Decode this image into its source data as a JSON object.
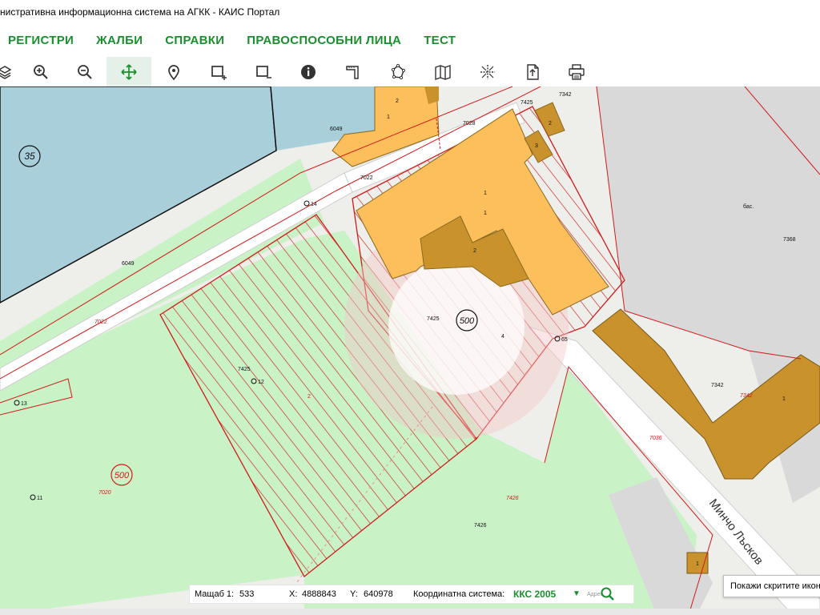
{
  "window": {
    "title": "нистративна информационна система на АГКК - КАИС Портал"
  },
  "menu": {
    "items": [
      "РЕГИСТРИ",
      "ЖАЛБИ",
      "СПРАВКИ",
      "ПРАВОСПОСОБНИ ЛИЦА",
      "ТЕСТ"
    ]
  },
  "toolbar": {
    "tools": [
      {
        "name": "layers-icon",
        "active": false
      },
      {
        "name": "zoom-in-icon",
        "active": false
      },
      {
        "name": "zoom-out-icon",
        "active": false
      },
      {
        "name": "pan-icon",
        "active": true
      },
      {
        "name": "location-pin-icon",
        "active": false
      },
      {
        "name": "select-rectangle-add-icon",
        "active": false
      },
      {
        "name": "select-rectangle-remove-icon",
        "active": false
      },
      {
        "name": "info-icon",
        "active": false
      },
      {
        "name": "measure-distance-icon",
        "active": false
      },
      {
        "name": "measure-area-icon",
        "active": false
      },
      {
        "name": "map-icon",
        "active": false
      },
      {
        "name": "coordinates-icon",
        "active": false
      },
      {
        "name": "export-icon",
        "active": false
      },
      {
        "name": "print-icon",
        "active": false
      }
    ]
  },
  "map": {
    "labels": {
      "lbl_35": "35",
      "lbl_6049_top": "6049",
      "lbl_1_top": "1",
      "lbl_2_top": "2",
      "lbl_7028": "7028",
      "lbl_7425_top": "7425",
      "lbl_7342_top": "7342",
      "lbl_2_small": "2",
      "lbl_3_small": "3",
      "lbl_7022_mid": "7022",
      "lbl_14": "14",
      "lbl_1_a": "1",
      "lbl_1_b": "1",
      "lbl_2_mid": "2",
      "lbl_6049_left": "6049",
      "lbl_bas": "бас.",
      "lbl_7368": "7368",
      "lbl_7022_red": "7022",
      "lbl_7425_center": "7425",
      "lbl_500_center": "500",
      "lbl_4": "4",
      "lbl_65": "65",
      "lbl_7425_left": "7425",
      "lbl_12": "12",
      "lbl_2_hatch": "2",
      "lbl_13": "13",
      "lbl_500_left": "500",
      "lbl_7020": "7020",
      "lbl_11": "11",
      "lbl_7342_right": "7342",
      "lbl_7342_red": "7342",
      "lbl_1_right": "1",
      "lbl_7036": "7036",
      "lbl_7426_red": "7426",
      "lbl_7426": "7426",
      "lbl_1_bottom": "1",
      "street_name": "Минчо Лъсков"
    }
  },
  "status": {
    "scale_label": "Мащаб 1:",
    "scale_value": "533",
    "x_label": "X:",
    "x_value": "4888843",
    "y_label": "Y:",
    "y_value": "640978",
    "crs_label": "Координатна система:",
    "crs_value": "ККС 2005",
    "crs_arrow": "▼",
    "search_hint": "Адрес"
  },
  "tooltip": {
    "text": "Покажи скритите икон"
  },
  "colors": {
    "menu_green": "#1a8f2e",
    "parcel_green": "#c9f2c7",
    "water_blue": "#a9cfdb",
    "building_orange": "#fdbf5c",
    "building_dark": "#c9922c",
    "parcel_red": "#d11a1a",
    "road_gray": "#e4e4e4",
    "block_gray": "#d9d9d9"
  }
}
